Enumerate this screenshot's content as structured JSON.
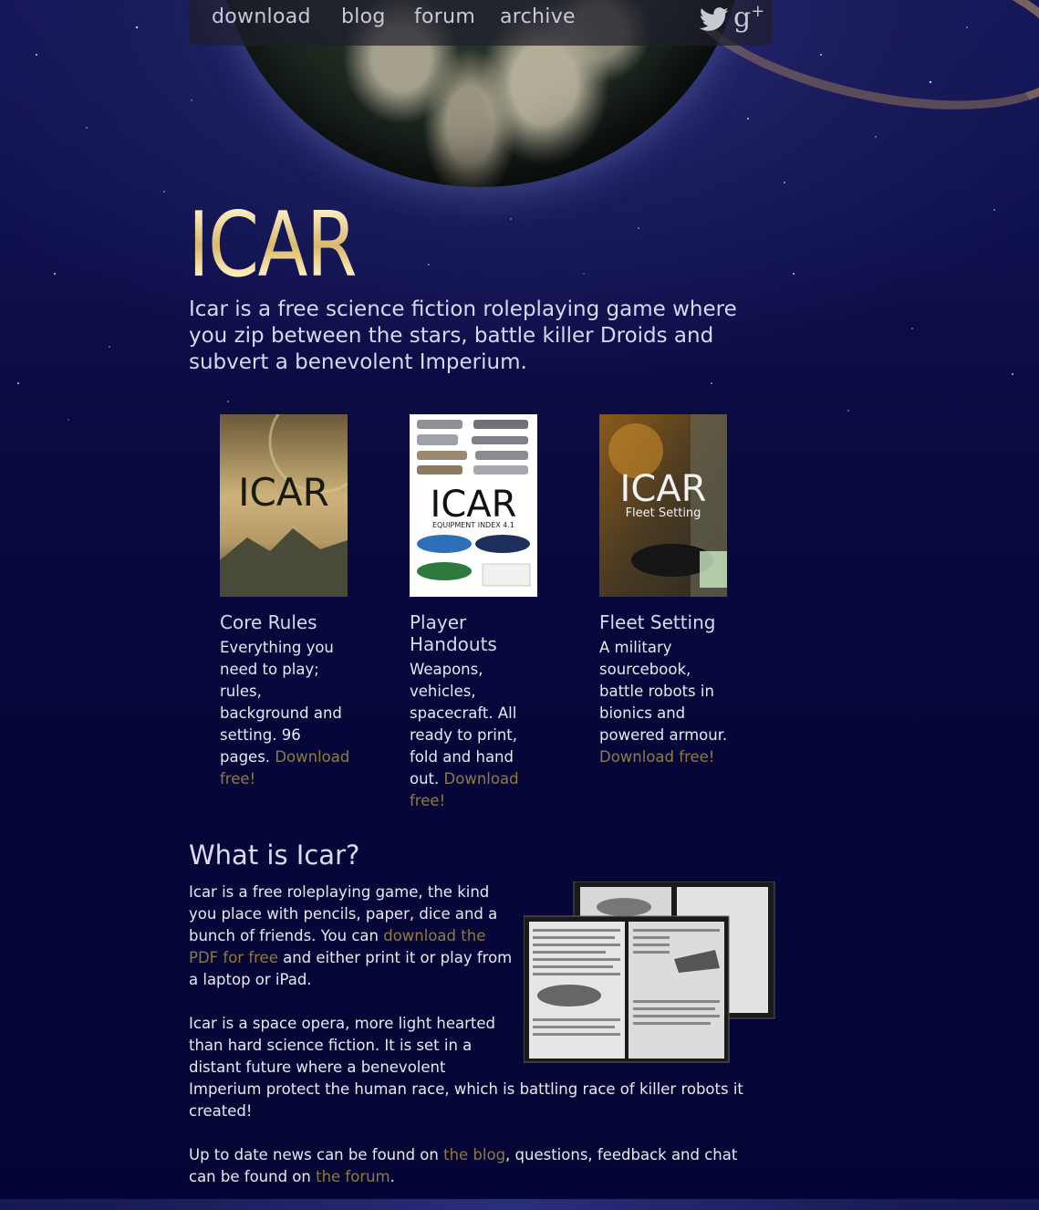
{
  "nav": {
    "links": [
      "download",
      "blog",
      "forum",
      "archive"
    ],
    "twitter_icon": "twitter-icon",
    "gplus_icon": "google-plus-icon",
    "gplus_label": "g"
  },
  "hero": {
    "logo": "ICAR",
    "tagline": "Icar is a free science fiction roleplaying game where you zip between the stars, battle killer Droids and subvert a benevolent Imperium."
  },
  "books": [
    {
      "cover_title": "ICAR",
      "title": "Core Rules",
      "description": "Everything you need to play; rules, background and setting. 96 pages.",
      "link": "Download free!"
    },
    {
      "cover_title": "ICAR",
      "cover_subtitle": "EQUIPMENT INDEX 4.1",
      "title": "Player Handouts",
      "description": "Weapons, vehicles, spacecraft. All ready to print, fold and hand out.",
      "link": "Download free!"
    },
    {
      "cover_title": "ICAR",
      "cover_subtitle": "Fleet Setting",
      "title": "Fleet Setting",
      "description": "A military sourcebook, battle robots in bionics and powered armour.",
      "link": "Download free!"
    }
  ],
  "whatis": {
    "heading": "What is Icar?",
    "p1_before": "Icar is a free roleplaying game, the kind you place with pencils, paper, dice and a bunch of friends. You can ",
    "p1_link": "download the PDF for free",
    "p1_after": " and either print it or play from a laptop or iPad.",
    "p2": "Icar is a space opera, more light hearted than hard science fiction. It is set in a distant future where a benevolent Imperium protect the human race, which is battling race of killer robots it created!",
    "p3_before": "Up to date news can be found on ",
    "p3_link1": "the blog",
    "p3_middle": ", questions, feedback and chat can be found on ",
    "p3_link2": "the forum",
    "p3_after": "."
  },
  "colors": {
    "link": "#8f7a45",
    "background": "#06073a",
    "text": "#e8e8f4"
  }
}
